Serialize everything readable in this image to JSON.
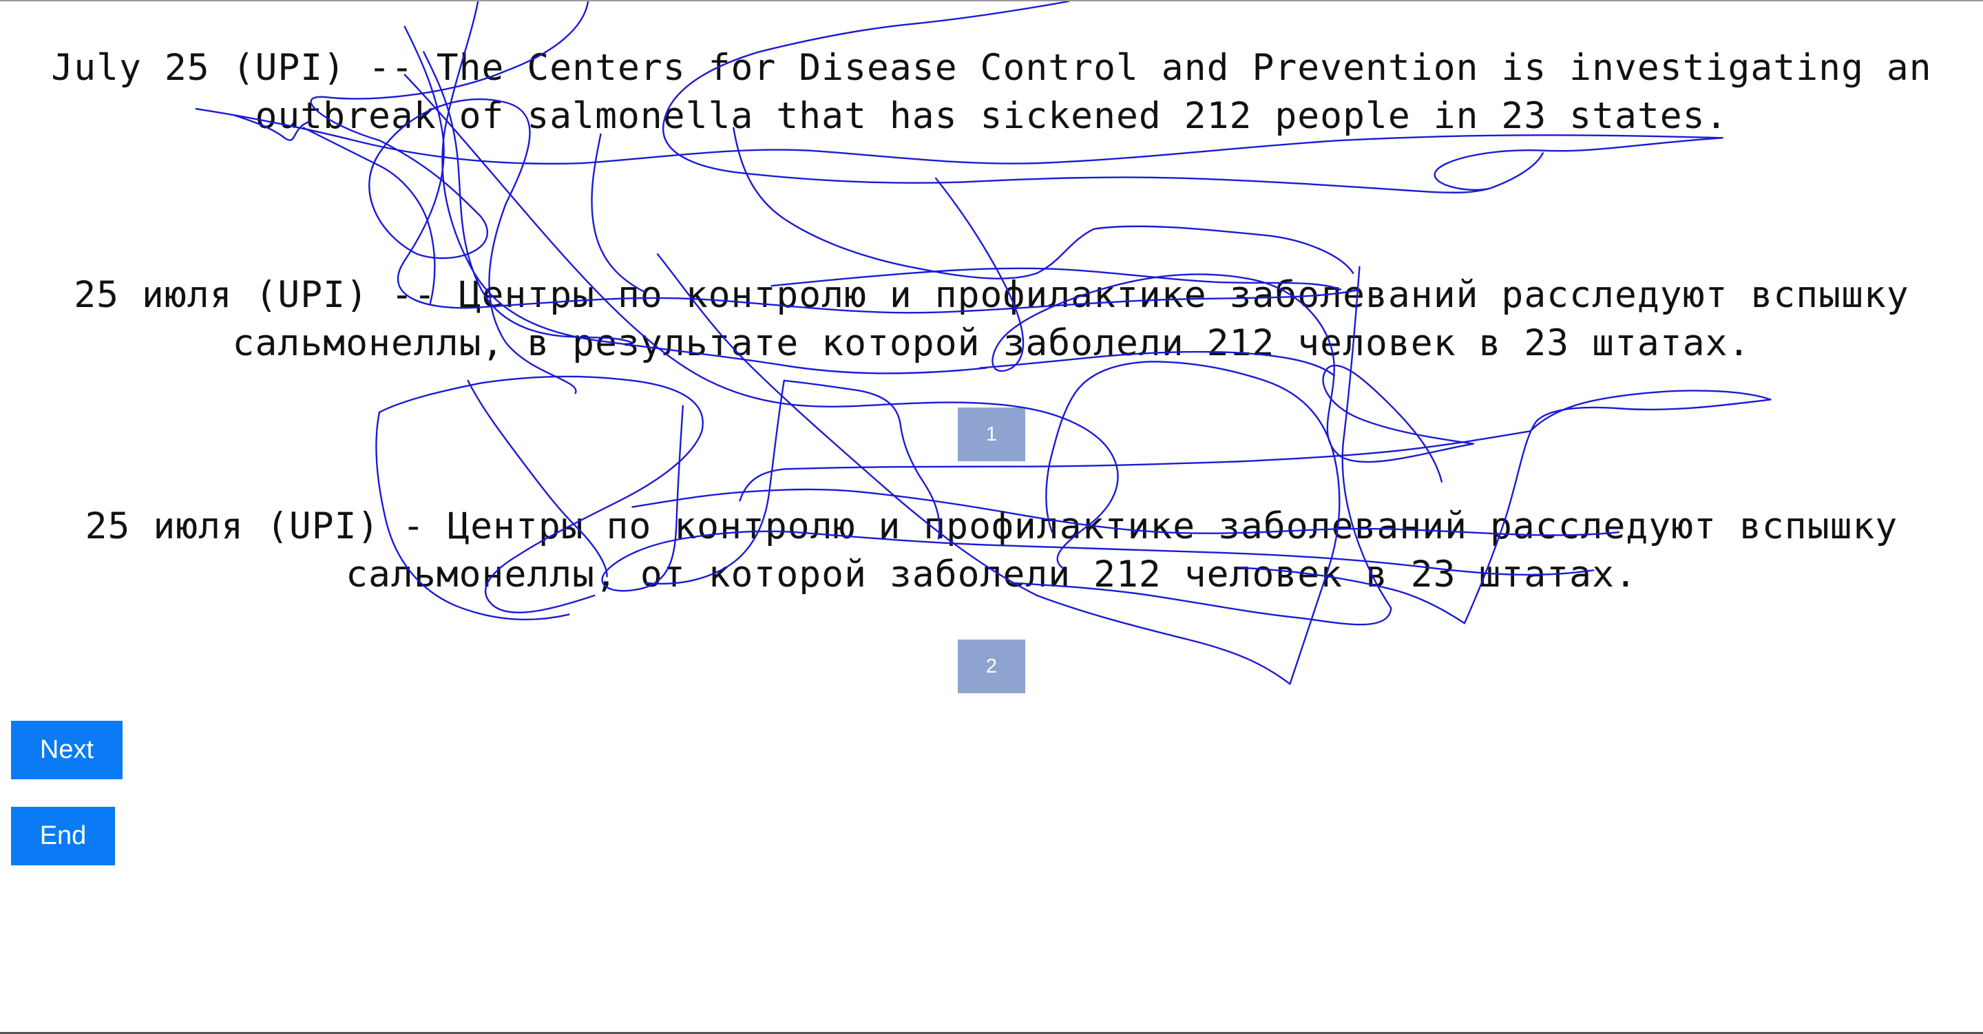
{
  "sentences": {
    "source": "July 25 (UPI) -- The Centers for Disease Control and Prevention is investigating an outbreak of salmonella that has sickened 212 people in 23 states.",
    "translation_1": "25 июля (UPI) -- Центры по контролю и профилактике заболеваний расследуют вспышку сальмонеллы, в результате которой заболели 212 человек в 23 штатах.",
    "translation_2": "25 июля (UPI) - Центры по контролю и профилактике заболеваний расследуют вспышку сальмонеллы, от которой заболели 212 человек в 23 штатах."
  },
  "choices": {
    "option_1_label": "1",
    "option_2_label": "2"
  },
  "actions": {
    "next_label": "Next",
    "end_label": "End"
  },
  "colors": {
    "choice_button": "#8ea3cf",
    "action_button": "#0a7bf5",
    "scribble_stroke": "#1a1ad6"
  }
}
